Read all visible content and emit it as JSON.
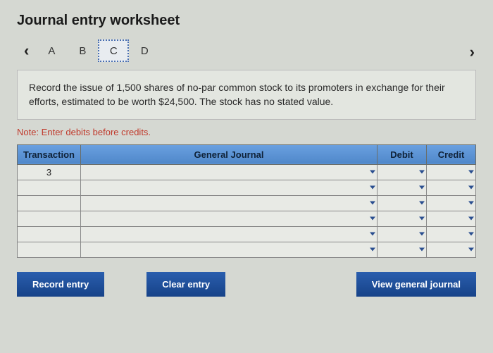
{
  "title": "Journal entry worksheet",
  "tabs": {
    "a": "A",
    "b": "B",
    "c": "C",
    "d": "D",
    "active": "C"
  },
  "instruction": "Record the issue of 1,500 shares of no-par common stock to its promoters in exchange for their efforts, estimated to be worth $24,500. The stock has no stated value.",
  "note": "Note: Enter debits before credits.",
  "table": {
    "headers": {
      "transaction": "Transaction",
      "gj": "General Journal",
      "debit": "Debit",
      "credit": "Credit"
    },
    "rows": [
      {
        "transaction": "3",
        "gj": "",
        "debit": "",
        "credit": ""
      },
      {
        "transaction": "",
        "gj": "",
        "debit": "",
        "credit": ""
      },
      {
        "transaction": "",
        "gj": "",
        "debit": "",
        "credit": ""
      },
      {
        "transaction": "",
        "gj": "",
        "debit": "",
        "credit": ""
      },
      {
        "transaction": "",
        "gj": "",
        "debit": "",
        "credit": ""
      },
      {
        "transaction": "",
        "gj": "",
        "debit": "",
        "credit": ""
      }
    ]
  },
  "buttons": {
    "record": "Record entry",
    "clear": "Clear entry",
    "view": "View general journal"
  }
}
